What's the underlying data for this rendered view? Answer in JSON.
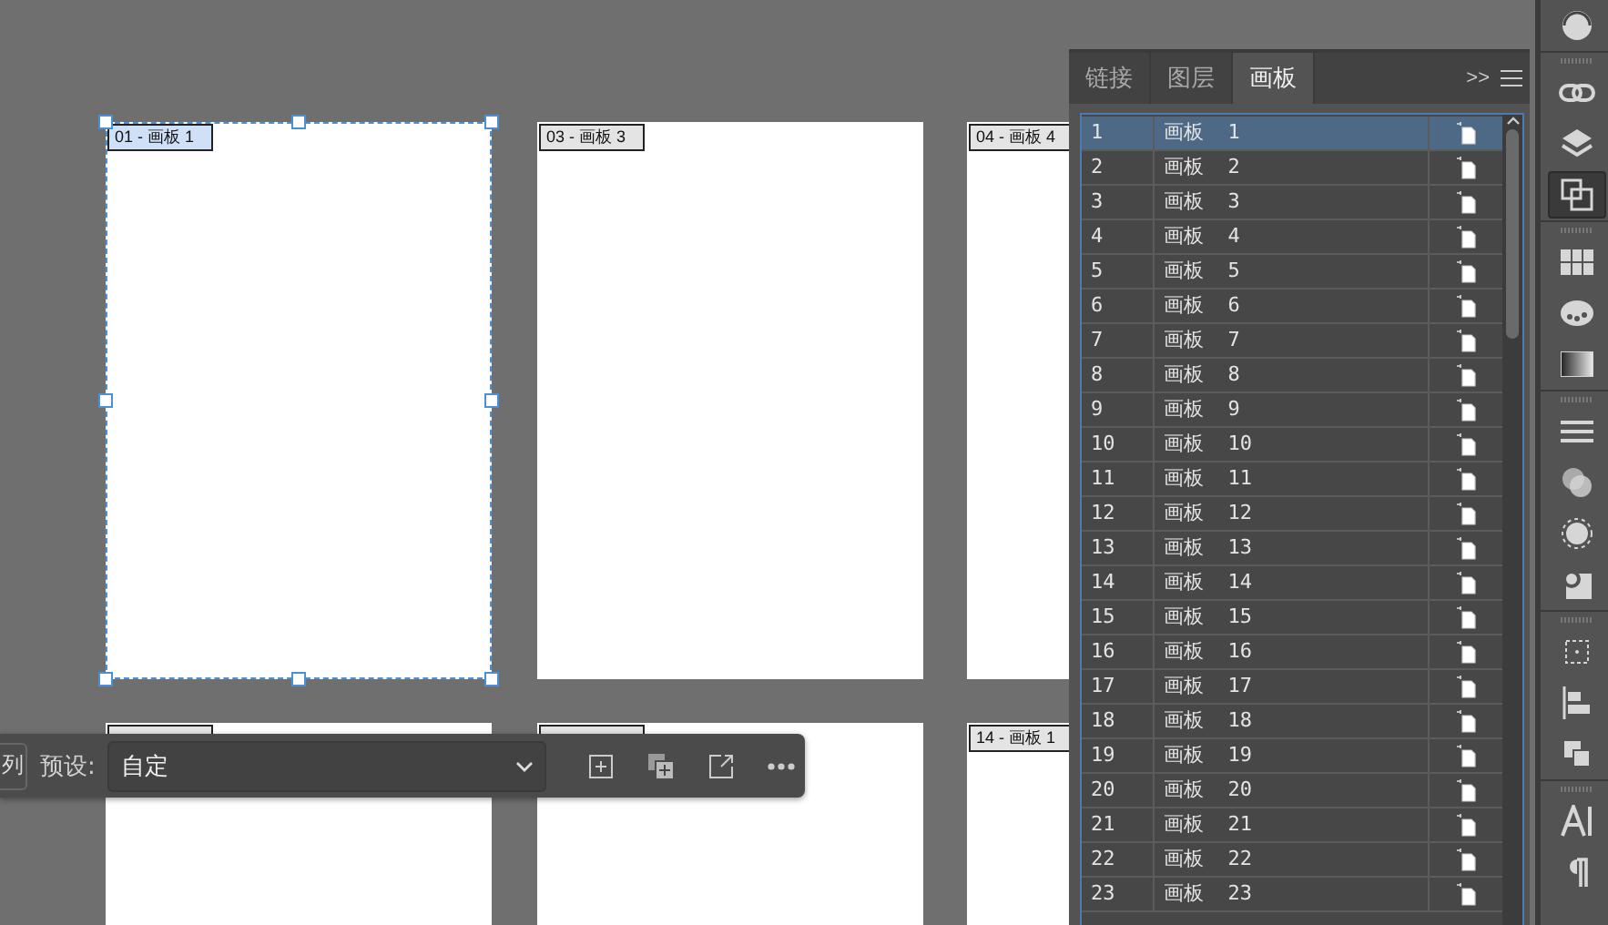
{
  "canvas": {
    "artboards": [
      {
        "label": "01 - 画板 1",
        "selected": true
      },
      {
        "label": "03 - 画板 3",
        "selected": false
      },
      {
        "label": "04 - 画板 4",
        "selected": false
      },
      {
        "selected": false
      },
      {
        "selected": false
      },
      {
        "label": "14 - 画板 1",
        "selected": false
      }
    ]
  },
  "artboard_toolbar": {
    "cut_button": "列",
    "preset_label": "预设:",
    "preset_value": "自定"
  },
  "panel": {
    "tabs": [
      {
        "label": "链接",
        "selected": false
      },
      {
        "label": "图层",
        "selected": false
      },
      {
        "label": "画板",
        "selected": true
      }
    ],
    "overflow": ">>",
    "rows": [
      {
        "number": "1",
        "name": "画板  1",
        "selected": true
      },
      {
        "number": "2",
        "name": "画板  2",
        "selected": false
      },
      {
        "number": "3",
        "name": "画板  3",
        "selected": false
      },
      {
        "number": "4",
        "name": "画板  4",
        "selected": false
      },
      {
        "number": "5",
        "name": "画板  5",
        "selected": false
      },
      {
        "number": "6",
        "name": "画板  6",
        "selected": false
      },
      {
        "number": "7",
        "name": "画板  7",
        "selected": false
      },
      {
        "number": "8",
        "name": "画板  8",
        "selected": false
      },
      {
        "number": "9",
        "name": "画板  9",
        "selected": false
      },
      {
        "number": "10",
        "name": "画板  10",
        "selected": false
      },
      {
        "number": "11",
        "name": "画板  11",
        "selected": false
      },
      {
        "number": "12",
        "name": "画板  12",
        "selected": false
      },
      {
        "number": "13",
        "name": "画板  13",
        "selected": false
      },
      {
        "number": "14",
        "name": "画板  14",
        "selected": false
      },
      {
        "number": "15",
        "name": "画板  15",
        "selected": false
      },
      {
        "number": "16",
        "name": "画板  16",
        "selected": false
      },
      {
        "number": "17",
        "name": "画板  17",
        "selected": false
      },
      {
        "number": "18",
        "name": "画板  18",
        "selected": false
      },
      {
        "number": "19",
        "name": "画板  19",
        "selected": false
      },
      {
        "number": "20",
        "name": "画板  20",
        "selected": false
      },
      {
        "number": "21",
        "name": "画板  21",
        "selected": false
      },
      {
        "number": "22",
        "name": "画板  22",
        "selected": false
      },
      {
        "number": "23",
        "name": "画板  23",
        "selected": false
      }
    ]
  },
  "dock": {
    "icons": [
      {
        "kind": "sync",
        "selected": false
      },
      {
        "kind": "grip"
      },
      {
        "kind": "links",
        "selected": false
      },
      {
        "kind": "layers",
        "selected": false
      },
      {
        "kind": "artboards",
        "selected": true
      },
      {
        "kind": "grip"
      },
      {
        "kind": "swatches",
        "selected": false
      },
      {
        "kind": "palette",
        "selected": false
      },
      {
        "kind": "gradient",
        "selected": false
      },
      {
        "kind": "grip"
      },
      {
        "kind": "stroke",
        "selected": false
      },
      {
        "kind": "transparency",
        "selected": false
      },
      {
        "kind": "appearance",
        "selected": false
      },
      {
        "kind": "styles",
        "selected": false
      },
      {
        "kind": "grip"
      },
      {
        "kind": "transform",
        "selected": false
      },
      {
        "kind": "align",
        "selected": false
      },
      {
        "kind": "pathfinder",
        "selected": false
      },
      {
        "kind": "grip"
      },
      {
        "kind": "character",
        "selected": false
      },
      {
        "kind": "paragraph",
        "selected": false
      }
    ]
  }
}
